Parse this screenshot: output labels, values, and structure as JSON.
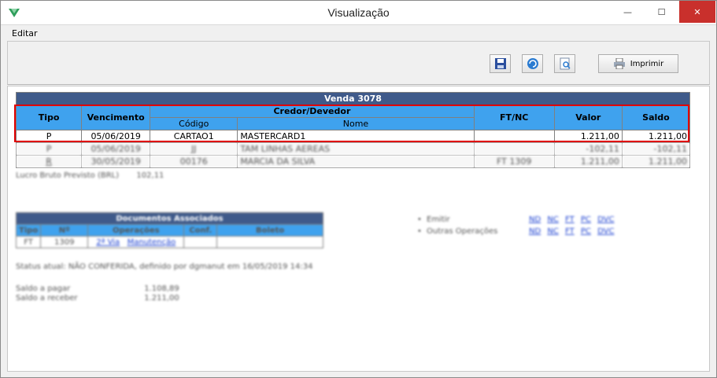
{
  "window": {
    "title": "Visualização",
    "minimize_glyph": "—",
    "maximize_glyph": "☐",
    "close_glyph": "✕"
  },
  "menu": {
    "edit_label": "Editar"
  },
  "toolbar": {
    "print_label": "Imprimir"
  },
  "venda": {
    "header": "Venda  3078",
    "columns": {
      "tipo": "Tipo",
      "vencimento": "Vencimento",
      "credor_devedor": "Credor/Devedor",
      "codigo": "Código",
      "nome": "Nome",
      "ft_nc": "FT/NC",
      "valor": "Valor",
      "saldo": "Saldo"
    },
    "rows": [
      {
        "tipo": "P",
        "vencimento": "05/06/2019",
        "codigo": "CARTAO1",
        "nome": "MASTERCARD1",
        "ft_nc": "",
        "valor": "1.211,00",
        "saldo": "1.211,00"
      },
      {
        "tipo": "P",
        "vencimento": "05/06/2019",
        "codigo": "JJ",
        "nome": "TAM LINHAS AEREAS",
        "ft_nc": "",
        "valor": "-102,11",
        "saldo": "-102,11"
      },
      {
        "tipo": "R",
        "vencimento": "30/05/2019",
        "codigo": "00176",
        "nome": "MARCIA DA SILVA",
        "ft_nc": "FT 1309",
        "valor": "1.211,00",
        "saldo": "1.211,00"
      }
    ]
  },
  "lucro": {
    "label": "Lucro Bruto Previsto (BRL)",
    "value": "102,11"
  },
  "documentos": {
    "title": "Documentos Associados",
    "columns": [
      "Tipo",
      "Nº",
      "Operações",
      "Conf.",
      "Boleto"
    ],
    "row": {
      "tipo": "FT",
      "numero": "1309",
      "op_via": "2ª Via",
      "op_manut": "Manutenção",
      "conf": "",
      "boleto": ""
    }
  },
  "operacoes": {
    "emitir_label": "Emitir",
    "outras_label": "Outras Operações",
    "links": [
      "ND",
      "NC",
      "FT",
      "PC",
      "DVC"
    ]
  },
  "status": {
    "text": "Status atual: NÃO CONFERIDA, definido por dgmanut em 16/05/2019 14:34"
  },
  "saldos": {
    "pagar_label": "Saldo a pagar",
    "pagar_value": "1.108,89",
    "receber_label": "Saldo a receber",
    "receber_value": "1.211,00"
  }
}
